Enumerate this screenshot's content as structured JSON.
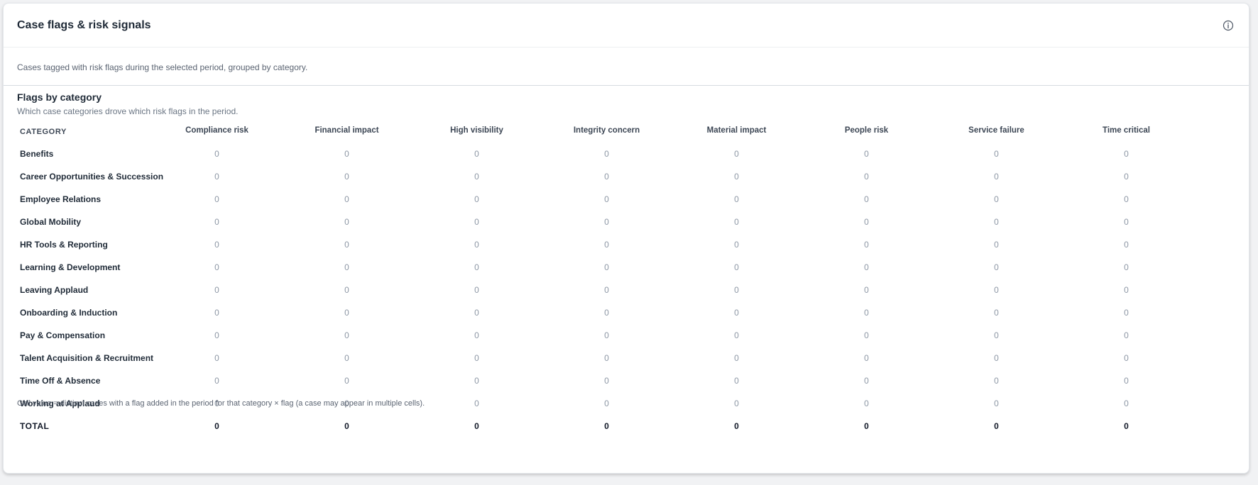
{
  "card": {
    "title": "Case flags & risk signals",
    "description": "Cases tagged with risk flags during the selected period, grouped by category."
  },
  "section": {
    "title": "Flags by category",
    "subtitle": "Which case categories drove which risk flags in the period."
  },
  "table": {
    "category_header": "CATEGORY",
    "columns": [
      "Compliance risk",
      "Financial impact",
      "High visibility",
      "Integrity concern",
      "Material impact",
      "People risk",
      "Service failure",
      "Time critical"
    ],
    "rows": [
      {
        "category": "Benefits",
        "values": [
          "0",
          "0",
          "0",
          "0",
          "0",
          "0",
          "0",
          "0"
        ]
      },
      {
        "category": "Career Opportunities & Succession",
        "values": [
          "0",
          "0",
          "0",
          "0",
          "0",
          "0",
          "0",
          "0"
        ]
      },
      {
        "category": "Employee Relations",
        "values": [
          "0",
          "0",
          "0",
          "0",
          "0",
          "0",
          "0",
          "0"
        ]
      },
      {
        "category": "Global Mobility",
        "values": [
          "0",
          "0",
          "0",
          "0",
          "0",
          "0",
          "0",
          "0"
        ]
      },
      {
        "category": "HR Tools & Reporting",
        "values": [
          "0",
          "0",
          "0",
          "0",
          "0",
          "0",
          "0",
          "0"
        ]
      },
      {
        "category": "Learning & Development",
        "values": [
          "0",
          "0",
          "0",
          "0",
          "0",
          "0",
          "0",
          "0"
        ]
      },
      {
        "category": "Leaving Applaud",
        "values": [
          "0",
          "0",
          "0",
          "0",
          "0",
          "0",
          "0",
          "0"
        ]
      },
      {
        "category": "Onboarding & Induction",
        "values": [
          "0",
          "0",
          "0",
          "0",
          "0",
          "0",
          "0",
          "0"
        ]
      },
      {
        "category": "Pay & Compensation",
        "values": [
          "0",
          "0",
          "0",
          "0",
          "0",
          "0",
          "0",
          "0"
        ]
      },
      {
        "category": "Talent Acquisition & Recruitment",
        "values": [
          "0",
          "0",
          "0",
          "0",
          "0",
          "0",
          "0",
          "0"
        ]
      },
      {
        "category": "Time Off & Absence",
        "values": [
          "0",
          "0",
          "0",
          "0",
          "0",
          "0",
          "0",
          "0"
        ]
      },
      {
        "category": "Working at Applaud",
        "values": [
          "0",
          "0",
          "0",
          "0",
          "0",
          "0",
          "0",
          "0"
        ]
      }
    ],
    "total": {
      "label": "TOTAL",
      "values": [
        "0",
        "0",
        "0",
        "0",
        "0",
        "0",
        "0",
        "0"
      ]
    }
  },
  "footnote": "Cell value = distinct cases with a flag added in the period for that category × flag (a case may appear in multiple cells).",
  "icons": {
    "info": "info-icon"
  }
}
